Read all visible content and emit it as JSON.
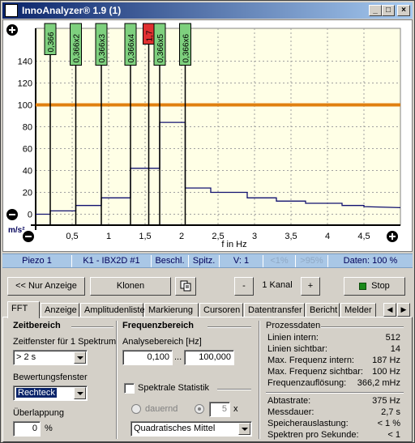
{
  "window": {
    "title": "InnoAnalyzer® 1.9 (1)",
    "controls": [
      "_",
      "□",
      "×"
    ]
  },
  "chart_data": {
    "type": "line",
    "xlabel": "f in Hz",
    "ylabel": "m/s²",
    "xlim": [
      0,
      5
    ],
    "ylim": [
      -10,
      170
    ],
    "x_ticks": [
      "0,5",
      "1",
      "1,5",
      "2",
      "2,5",
      "3",
      "3,5",
      "4",
      "4,5"
    ],
    "y_ticks": [
      "0",
      "20",
      "40",
      "60",
      "80",
      "100",
      "120",
      "140"
    ],
    "grid": true,
    "threshold_line": {
      "y": 100,
      "color": "#e08010"
    },
    "series": [
      {
        "color": "#101070",
        "steps": [
          [
            0.0,
            0
          ],
          [
            0.2,
            0
          ],
          [
            0.2,
            3
          ],
          [
            0.55,
            3
          ],
          [
            0.55,
            8
          ],
          [
            0.9,
            8
          ],
          [
            0.9,
            15
          ],
          [
            1.3,
            15
          ],
          [
            1.3,
            42
          ],
          [
            1.7,
            42
          ],
          [
            1.7,
            84
          ],
          [
            2.05,
            84
          ],
          [
            2.05,
            24
          ],
          [
            2.4,
            24
          ],
          [
            2.4,
            20
          ],
          [
            2.9,
            20
          ],
          [
            2.9,
            15
          ],
          [
            3.3,
            15
          ],
          [
            3.3,
            12
          ],
          [
            3.7,
            12
          ],
          [
            3.7,
            10
          ],
          [
            4.2,
            10
          ],
          [
            4.2,
            8
          ],
          [
            4.5,
            8
          ],
          [
            4.5,
            7
          ],
          [
            5.0,
            6
          ]
        ]
      }
    ],
    "cursors": [
      {
        "x": 0.2,
        "label": "0,366",
        "color": "#7ed07e"
      },
      {
        "x": 0.55,
        "label": "0,366x2",
        "color": "#7ed07e"
      },
      {
        "x": 0.9,
        "label": "0,366x3",
        "color": "#7ed07e"
      },
      {
        "x": 1.3,
        "label": "0,366x4",
        "color": "#7ed07e"
      },
      {
        "x": 1.55,
        "label": "1,7",
        "color": "#e03030"
      },
      {
        "x": 1.7,
        "label": "0,366x5",
        "color": "#7ed07e"
      },
      {
        "x": 2.05,
        "label": "0,366x6",
        "color": "#7ed07e"
      }
    ]
  },
  "status_bar": {
    "cells": [
      "Piezo 1",
      "K1 - IBX2D #1",
      "Beschl.",
      "Spitz.",
      "V: 1",
      "<1%",
      ">95%",
      "Daten: 100 %"
    ]
  },
  "toolbar": {
    "nur_anzeige": "<< Nur Anzeige",
    "klonen": "Klonen",
    "minus": "-",
    "kanal": "1 Kanal",
    "plus": "+",
    "stop": "Stop",
    "stop_color": "#1a8a1a"
  },
  "tabs": [
    "FFT",
    "Anzeige",
    "Amplitudenliste",
    "Markierung",
    "Cursoren",
    "Datentransfer",
    "Bericht",
    "Melder"
  ],
  "zeitbereich": {
    "heading": "Zeitbereich",
    "zeitfenster_label": "Zeitfenster für 1 Spektrum",
    "zeitfenster_value": ">    2   s",
    "bewertung_label": "Bewertungsfenster",
    "bewertung_value": "Rechteck",
    "ueberlappung_label": "Überlappung",
    "ueberlappung_value": "0",
    "ueberlappung_unit": "%"
  },
  "frequenzbereich": {
    "heading": "Frequenzbereich",
    "analyse_label": "Analysebereich [Hz]",
    "from": "0,100",
    "sep": "...",
    "to": "100,000",
    "spektrale_label": "Spektrale Statistik",
    "dauernd": "dauernd",
    "count": "5",
    "count_unit": "x",
    "mittel": "Quadratisches Mittel"
  },
  "prozessdaten": {
    "heading": "Prozessdaten",
    "rows_top": [
      {
        "label": "Linien intern:",
        "value": "512"
      },
      {
        "label": "Linien sichtbar:",
        "value": "14"
      },
      {
        "label": "Max. Frequenz intern:",
        "value": "187 Hz"
      },
      {
        "label": "Max. Frequenz sichtbar:",
        "value": "100 Hz"
      },
      {
        "label": "Frequenzauflösung:",
        "value": "366,2 mHz"
      }
    ],
    "rows_bottom": [
      {
        "label": "Abtastrate:",
        "value": "375 Hz"
      },
      {
        "label": "Messdauer:",
        "value": "2,7 s"
      },
      {
        "label": "Speicherauslastung:",
        "value": "< 1 %"
      },
      {
        "label": "Spektren pro Sekunde:",
        "value": "< 1"
      }
    ]
  }
}
